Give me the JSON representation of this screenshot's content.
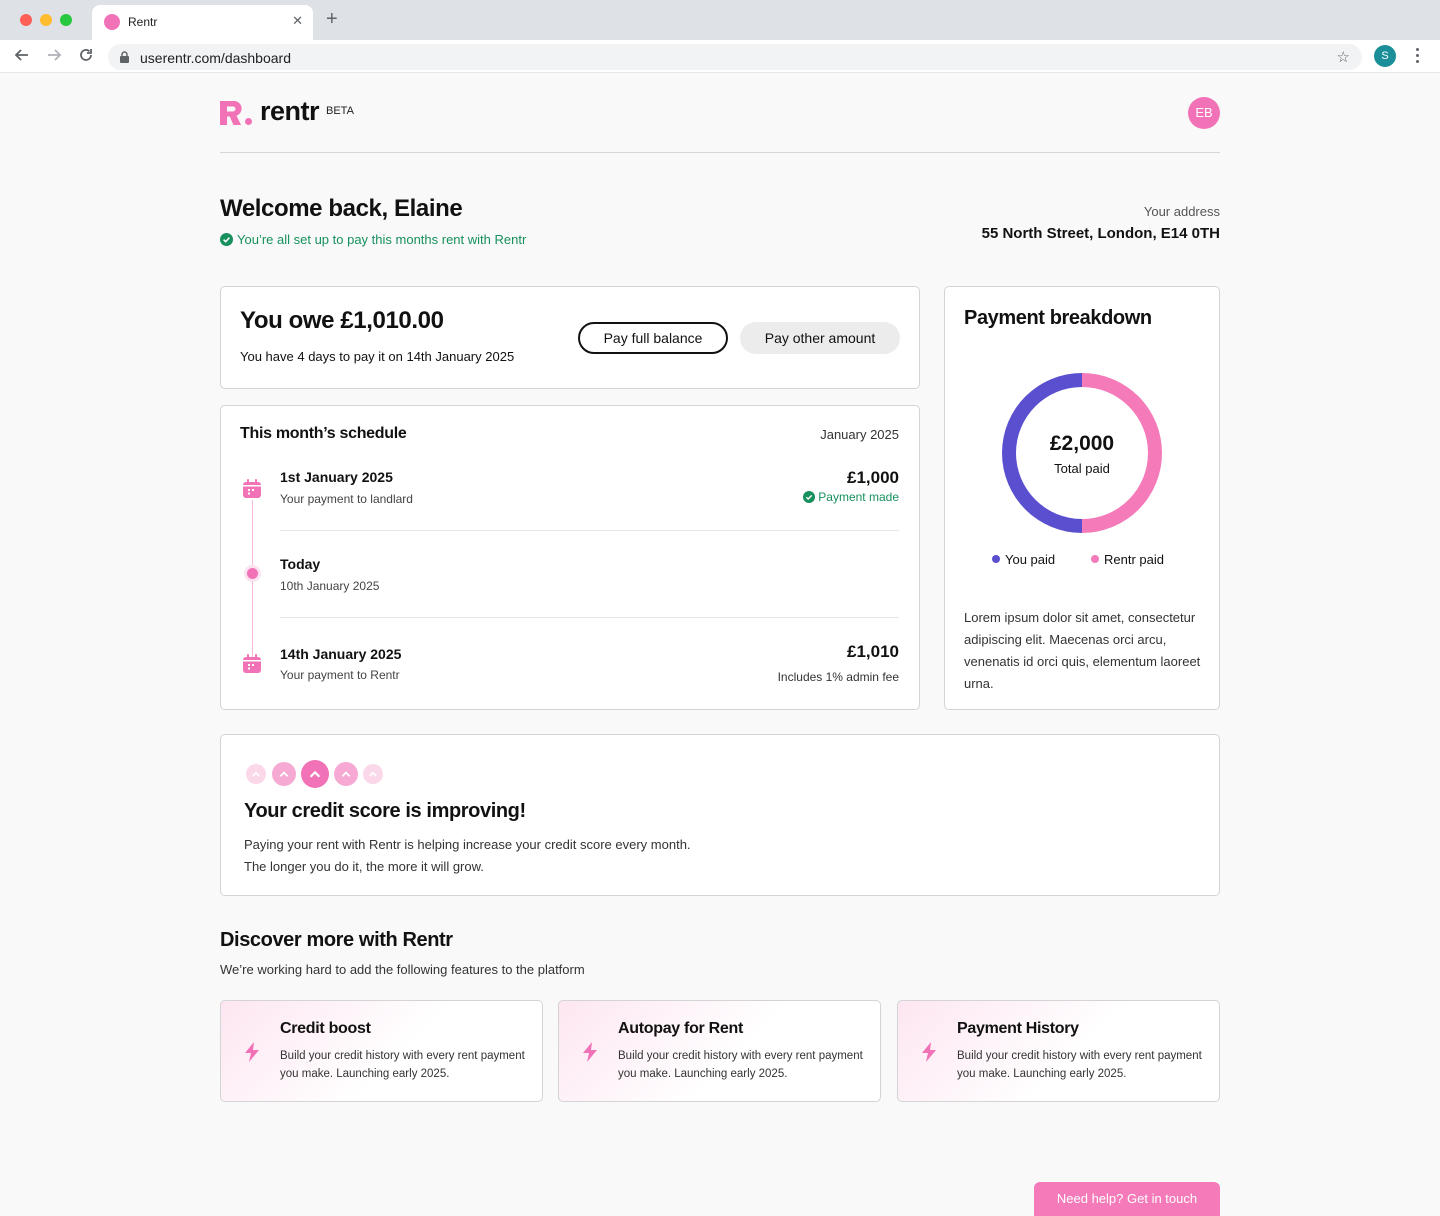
{
  "browser": {
    "tab_title": "Rentr",
    "url": "userentr.com/dashboard",
    "profile_initial": "S"
  },
  "header": {
    "logo_text": "rentr",
    "beta_label": "BETA",
    "avatar_initials": "EB"
  },
  "welcome": {
    "title": "Welcome back, Elaine",
    "status": "You’re all set up to pay this months rent with Rentr",
    "address_label": "Your address",
    "address": "55 North Street, London, E14 0TH"
  },
  "owe": {
    "amount_text": "You owe £1,010.00",
    "due_text": "You have 4 days to pay it on 14th January 2025",
    "pay_full_label": "Pay full balance",
    "pay_other_label": "Pay other amount"
  },
  "schedule": {
    "title": "This month’s schedule",
    "month": "January 2025",
    "rows": [
      {
        "title": "1st January 2025",
        "subtitle": "Your payment to landlard",
        "amount": "£1,000",
        "status": "Payment made"
      },
      {
        "title": "Today",
        "subtitle": "10th January 2025"
      },
      {
        "title": "14th January 2025",
        "subtitle": "Your payment to Rentr",
        "amount": "£1,010",
        "note": "Includes 1% admin fee"
      }
    ]
  },
  "breakdown": {
    "title": "Payment breakdown",
    "total": "£2,000",
    "total_label": "Total paid",
    "legend": [
      {
        "label": "You paid",
        "color": "#5a4fcf"
      },
      {
        "label": "Rentr paid",
        "color": "#f57ab9"
      }
    ],
    "text": "Lorem ipsum dolor sit amet, consectetur adipiscing elit. Maecenas orci arcu, venenatis id orci quis, elementum laoreet urna."
  },
  "credit": {
    "title": "Your credit score is improving!",
    "text": "Paying your rent with Rentr is helping increase your credit score every month. The longer you do it, the more it will grow."
  },
  "discover": {
    "title": "Discover more with Rentr",
    "subtitle": "We’re working hard to add the following features to the platform",
    "features": [
      {
        "title": "Credit boost",
        "text": "Build your credit history with every rent payment you make. Launching early 2025."
      },
      {
        "title": "Autopay for Rent",
        "text": "Build your credit history with every rent payment you make. Launching early 2025."
      },
      {
        "title": "Payment History",
        "text": "Build your credit history with every rent payment you make. Launching early 2025."
      }
    ]
  },
  "help_button": "Need help? Get in touch",
  "colors": {
    "brand_pink": "#f172b6",
    "brand_purple": "#5a4fcf",
    "success_green": "#17905e"
  }
}
